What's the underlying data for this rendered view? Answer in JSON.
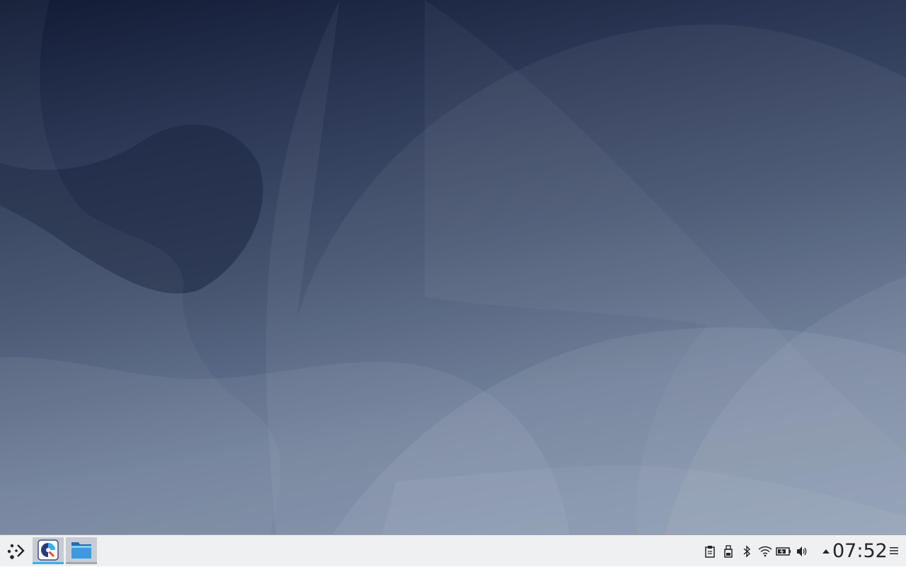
{
  "desktop": {
    "wallpaper_name": "kde-plasma-default-wallpaper",
    "colors": {
      "top": "#121b35",
      "mid": "#485672",
      "bottom": "#7f90aa"
    }
  },
  "taskbar": {
    "background": "#eff0f1",
    "launcher_icon": "application-launcher-icon",
    "tasks": [
      {
        "name": "discover",
        "icon": "discover-icon"
      },
      {
        "name": "file-manager",
        "icon": "folder-icon"
      }
    ],
    "tray": [
      {
        "name": "clipboard",
        "icon": "clipboard-icon"
      },
      {
        "name": "usb-device",
        "icon": "usb-drive-icon"
      },
      {
        "name": "bluetooth",
        "icon": "bluetooth-icon"
      },
      {
        "name": "wifi",
        "icon": "wifi-icon"
      },
      {
        "name": "battery",
        "icon": "battery-icon"
      },
      {
        "name": "volume",
        "icon": "volume-icon"
      },
      {
        "name": "show-hidden",
        "icon": "caret-up-icon"
      }
    ],
    "clock": "07:52",
    "accent": "#3daee9"
  }
}
